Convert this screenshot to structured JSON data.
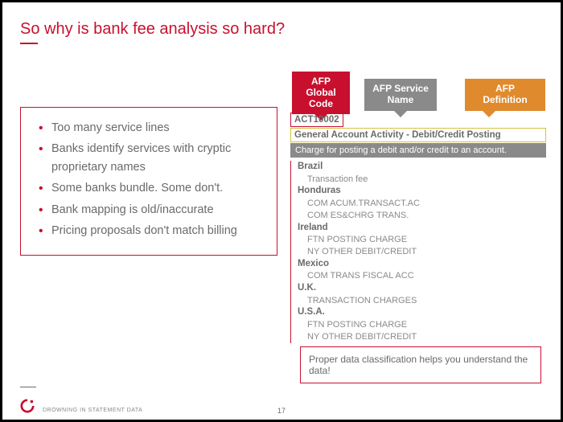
{
  "title": "So why is bank fee analysis so hard?",
  "bullets": [
    "Too many service lines",
    "Banks identify services with cryptic proprietary names",
    "Some banks bundle. Some don't.",
    "Bank mapping is old/inaccurate",
    "Pricing proposals don't match billing"
  ],
  "tags": {
    "global_code": "AFP Global Code",
    "service_name": "AFP Service Name",
    "definition": "AFP Definition"
  },
  "panel": {
    "code": "ACT10002",
    "service_name": "General Account Activity - Debit/Credit Posting",
    "definition": "Charge for posting a debit and/or credit to an account.",
    "groups": [
      {
        "country": "Brazil",
        "services": [
          "Transaction fee"
        ]
      },
      {
        "country": "Honduras",
        "services": [
          "COM ACUM.TRANSACT.AC",
          "COM ES&CHRG TRANS."
        ]
      },
      {
        "country": "Ireland",
        "services": [
          "FTN POSTING CHARGE",
          "NY OTHER DEBIT/CREDIT"
        ]
      },
      {
        "country": "Mexico",
        "services": [
          "COM TRANS FISCAL ACC"
        ]
      },
      {
        "country": "U.K.",
        "services": [
          "TRANSACTION CHARGES"
        ]
      },
      {
        "country": "U.S.A.",
        "services": [
          "FTN POSTING CHARGE",
          "NY OTHER DEBIT/CREDIT"
        ]
      }
    ]
  },
  "note": "Proper data classification helps you understand the data!",
  "footer": {
    "text": "DROWNING IN STATEMENT DATA",
    "page": "17"
  }
}
